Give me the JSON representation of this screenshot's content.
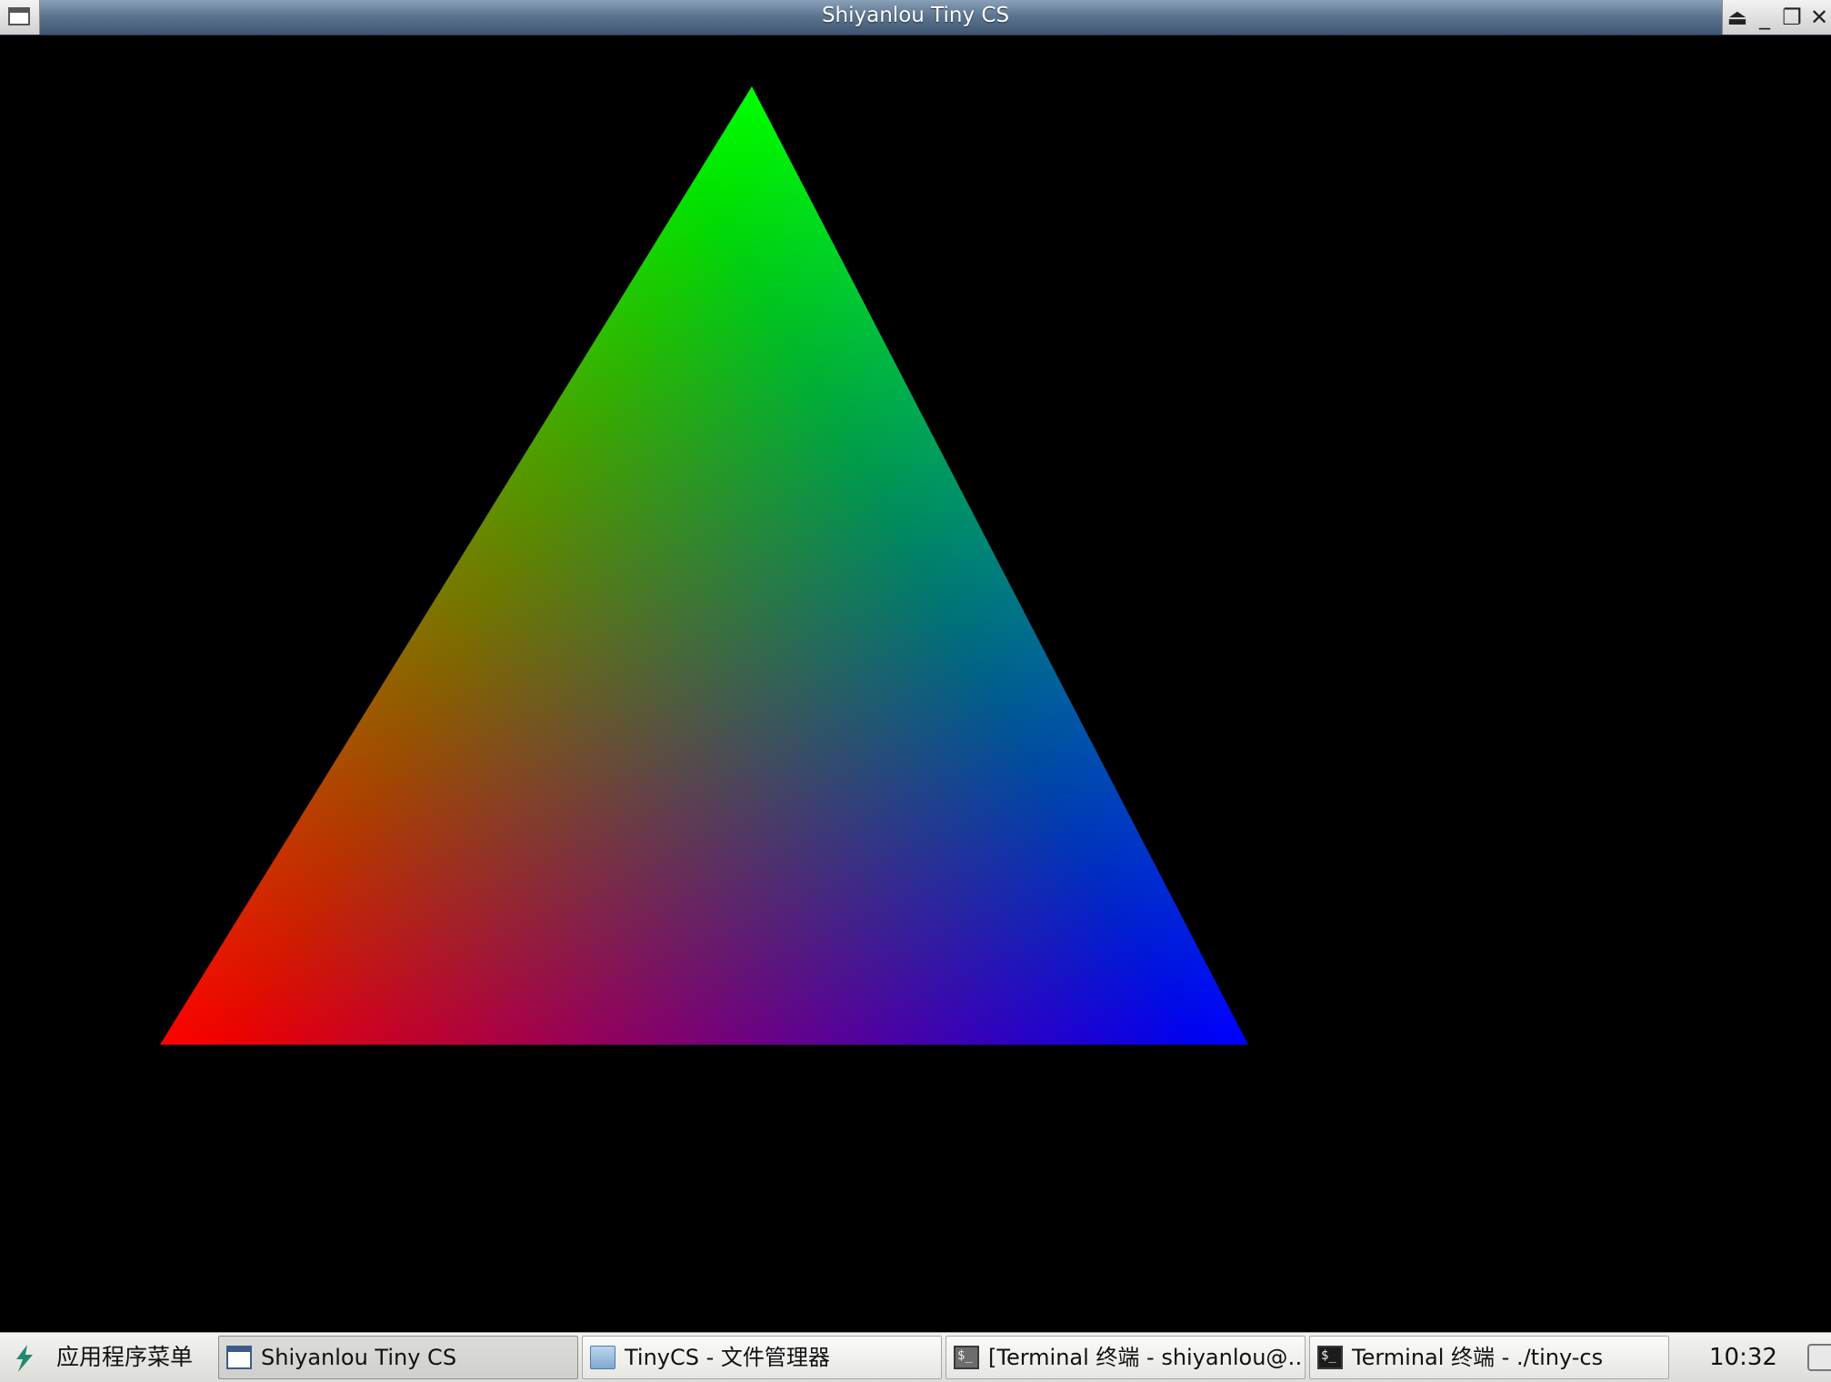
{
  "window": {
    "title": "Shiyanlou Tiny CS",
    "controls": {
      "shade_glyph": "⏏",
      "minimize_glyph": "_",
      "maximize_glyph": "❐",
      "close_glyph": "✕"
    }
  },
  "render": {
    "background": "#000000",
    "triangle_vertex_colors": {
      "top": "#00ff00",
      "bottom_left": "#ff0000",
      "bottom_right": "#0000ff"
    }
  },
  "taskbar": {
    "start_label": "应用程序菜单",
    "tasks": [
      {
        "label": "Shiyanlou Tiny CS",
        "icon": "window-icon",
        "active": true
      },
      {
        "label": "TinyCS - 文件管理器",
        "icon": "folder-icon",
        "active": false
      },
      {
        "label": "[Terminal 终端 - shiyanlou@…",
        "icon": "terminal-icon",
        "active": false
      },
      {
        "label": "Terminal 终端 - ./tiny-cs",
        "icon": "terminal-icon",
        "active": false
      }
    ],
    "clock": "10:32",
    "terminal_icon_glyph": "$_"
  }
}
